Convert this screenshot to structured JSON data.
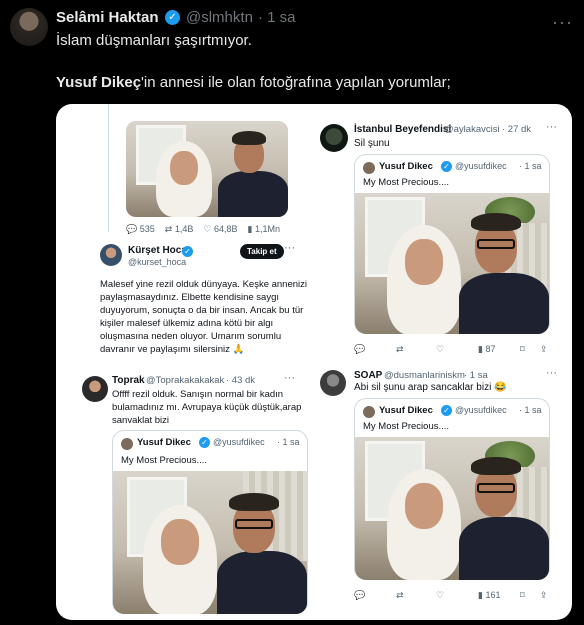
{
  "tweet": {
    "author_name": "Selâmi Haktan",
    "author_handle": "@slmhktn",
    "time": "· 1 sa",
    "line1": "İslam düşmanları şaşırtmıyor.",
    "line2_bold": "Yusuf Dikeç",
    "line2_rest": "'in annesi ile olan fotoğrafına yapılan yorumlar;"
  },
  "left_top_stats": {
    "replies": "535",
    "retweets": "1,4B",
    "likes": "64,8B",
    "views": "1,1Mn"
  },
  "kursat": {
    "name": "Kürşet Hoca",
    "handle": "@kurset_hoca",
    "follow": "Takip et",
    "lines": [
      "Malesef yine rezil olduk dünyaya. Keşke annenizi",
      "paylaşmasaydınız. Elbette kendisine saygı",
      "duyuyorum, sonuçta o da bir insan. Ancak bu tür",
      "kişiler malesef ülkemiz adına kötü bir algı",
      "oluşmasına neden oluyor. Umarım sorumlu",
      "davranır ve paylaşımı silersiniz 🙏"
    ]
  },
  "toprak": {
    "name": "Toprak",
    "handle": "@Toprakakakakak",
    "time": "· 43 dk",
    "lines": [
      "Offff rezil olduk. Sanışın normal bir kadın",
      "bulamadınız mı. Avrupaya küçük düştük,arap",
      "sanvaklat bizi"
    ]
  },
  "istanbul": {
    "name": "İstanbul Beyefendisi",
    "handle": "@aylakavcisi",
    "time": "· 27 dk",
    "text": "Sil şunu",
    "views": "87"
  },
  "soap": {
    "name": "SOAP",
    "handle": "@dusmanlariniskm",
    "time": "· 1 sa",
    "text": "Abi sil şunu arap sancaklar bizi 😂",
    "views": "161"
  },
  "quoted": {
    "name": "Yusuf Dikec",
    "handle": "@yusufdikec",
    "time": "· 1 sa",
    "text": "My Most Precious...."
  },
  "colors": {
    "accent": "#1d9bf0",
    "background": "#000000",
    "card": "#ffffff"
  }
}
